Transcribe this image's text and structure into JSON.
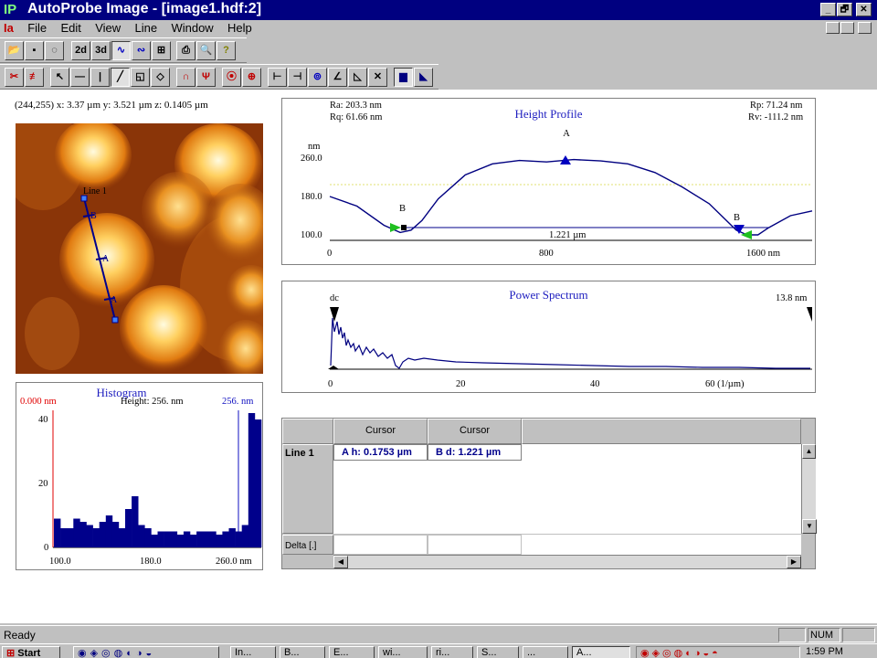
{
  "window": {
    "logo": "IP",
    "title": "AutoProbe Image - [image1.hdf:2]",
    "minimize": "_",
    "restore": "🗗",
    "close": "✕"
  },
  "menu": {
    "logo": "Ia",
    "items": [
      "File",
      "Edit",
      "View",
      "Line",
      "Window",
      "Help"
    ]
  },
  "toolbar1": {
    "view_2d": "2d",
    "view_3d": "3d"
  },
  "coord_readout": "(244,255)  x: 3.37 µm   y: 3.521 µm  z: 0.1405 µm",
  "image": {
    "line_label": "Line 1",
    "markers": [
      "B",
      "A",
      "A"
    ]
  },
  "histogram": {
    "title": "Histogram",
    "height_label": "Height: 256. nm",
    "left_marker": "0.000 nm",
    "right_marker": "256. nm",
    "y_ticks": [
      "40",
      "20",
      "0"
    ],
    "x_ticks": [
      "100.0",
      "180.0",
      "260.0 nm"
    ],
    "bars": [
      9,
      6,
      6,
      9,
      8,
      7,
      6,
      8,
      10,
      8,
      6,
      12,
      16,
      7,
      6,
      4,
      5,
      5,
      5,
      4,
      5,
      4,
      5,
      5,
      5,
      4,
      5,
      6,
      5,
      7,
      42,
      40
    ],
    "ylim": [
      0,
      45
    ]
  },
  "height_profile": {
    "title": "Height Profile",
    "ra": "Ra: 203.3 nm",
    "rq": "Rq: 61.66 nm",
    "rp": "Rp: 71.24 nm",
    "rv": "Rv: -111.2 nm",
    "unit": "nm",
    "y_ticks": [
      "260.0",
      "180.0",
      "100.0"
    ],
    "x_ticks": [
      "0",
      "800",
      "1600 nm"
    ],
    "distance_label": "1.221 µm",
    "cursor_a": "A",
    "cursor_b": "B",
    "cursor_end": "B",
    "x": [
      0,
      100,
      200,
      260,
      300,
      340,
      400,
      500,
      600,
      700,
      800,
      900,
      1000,
      1100,
      1200,
      1300,
      1400,
      1500,
      1540,
      1580,
      1620,
      1700,
      1780
    ],
    "y": [
      180,
      160,
      120,
      105,
      110,
      130,
      175,
      225,
      248,
      255,
      252,
      257,
      254,
      248,
      230,
      200,
      165,
      110,
      100,
      100,
      115,
      140,
      150
    ],
    "xlim": [
      0,
      1780
    ],
    "ylim": [
      90,
      290
    ]
  },
  "power_spectrum": {
    "title": "Power Spectrum",
    "dc_label": "dc",
    "right_marker": "13.8 nm",
    "x_ticks": [
      "0",
      "20",
      "40",
      "60 (1/µm)"
    ]
  },
  "cursor_table": {
    "col_headers": [
      "Cursor",
      "Cursor"
    ],
    "row_label": "Line 1",
    "cell_a": "A h: 0.1753 µm",
    "cell_b": "B d: 1.221 µm",
    "delta_label": "Delta [.]"
  },
  "statusbar": {
    "text": "Ready",
    "num": "NUM"
  },
  "taskbar": {
    "start": "Start",
    "clock": "1:59 PM",
    "items": [
      "In...",
      "B...",
      "E...",
      "wi...",
      "ri...",
      "S...",
      "...",
      "A..."
    ]
  }
}
